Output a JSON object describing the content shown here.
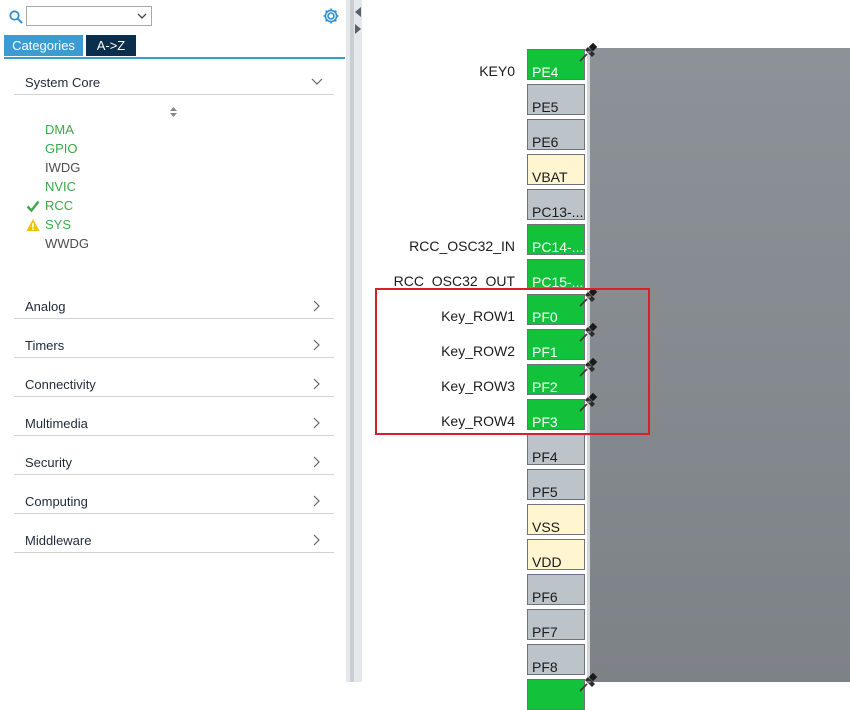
{
  "search": {
    "value": "",
    "placeholder": ""
  },
  "tabs": [
    {
      "label": "Categories",
      "active": true
    },
    {
      "label": "A->Z",
      "active": false
    }
  ],
  "sidebar": {
    "system_core": {
      "label": "System Core",
      "expanded": true,
      "items": [
        {
          "label": "DMA",
          "color": "#3aa84a",
          "status": ""
        },
        {
          "label": "GPIO",
          "color": "#3aa84a",
          "status": ""
        },
        {
          "label": "IWDG",
          "color": "#4d4d4d",
          "status": ""
        },
        {
          "label": "NVIC",
          "color": "#3aa84a",
          "status": ""
        },
        {
          "label": "RCC",
          "color": "#3aa84a",
          "status": "check"
        },
        {
          "label": "SYS",
          "color": "#3aa84a",
          "status": "warning"
        },
        {
          "label": "WWDG",
          "color": "#4d4d4d",
          "status": ""
        }
      ]
    },
    "categories": [
      {
        "label": "Analog"
      },
      {
        "label": "Timers"
      },
      {
        "label": "Connectivity"
      },
      {
        "label": "Multimedia"
      },
      {
        "label": "Security"
      },
      {
        "label": "Computing"
      },
      {
        "label": "Middleware"
      }
    ]
  },
  "chip": {
    "pins": [
      {
        "name": "PE4",
        "label": "KEY0",
        "type": "green",
        "pinned": true
      },
      {
        "name": "PE5",
        "label": "",
        "type": "gray",
        "pinned": false
      },
      {
        "name": "PE6",
        "label": "",
        "type": "gray",
        "pinned": false
      },
      {
        "name": "VBAT",
        "label": "",
        "type": "power",
        "pinned": false
      },
      {
        "name": "PC13-...",
        "label": "",
        "type": "gray",
        "pinned": false
      },
      {
        "name": "PC14-...",
        "label": "RCC_OSC32_IN",
        "type": "green",
        "pinned": false
      },
      {
        "name": "PC15-...",
        "label": "RCC_OSC32_OUT",
        "type": "green",
        "pinned": false
      },
      {
        "name": "PF0",
        "label": "Key_ROW1",
        "type": "green",
        "pinned": true
      },
      {
        "name": "PF1",
        "label": "Key_ROW2",
        "type": "green",
        "pinned": true
      },
      {
        "name": "PF2",
        "label": "Key_ROW3",
        "type": "green",
        "pinned": true
      },
      {
        "name": "PF3",
        "label": "Key_ROW4",
        "type": "green",
        "pinned": true
      },
      {
        "name": "PF4",
        "label": "",
        "type": "gray",
        "pinned": false
      },
      {
        "name": "PF5",
        "label": "",
        "type": "gray",
        "pinned": false
      },
      {
        "name": "VSS",
        "label": "",
        "type": "power",
        "pinned": false
      },
      {
        "name": "VDD",
        "label": "",
        "type": "power",
        "pinned": false
      },
      {
        "name": "PF6",
        "label": "",
        "type": "gray",
        "pinned": false
      },
      {
        "name": "PF7",
        "label": "",
        "type": "gray",
        "pinned": false
      },
      {
        "name": "PF8",
        "label": "",
        "type": "gray",
        "pinned": false
      },
      {
        "name": "",
        "label": "",
        "type": "green",
        "pinned": true
      }
    ],
    "colors": {
      "assigned": "#12c23a",
      "unassigned": "#bcc3c9",
      "power": "#fff5d1",
      "highlight": "#d8202a"
    }
  }
}
